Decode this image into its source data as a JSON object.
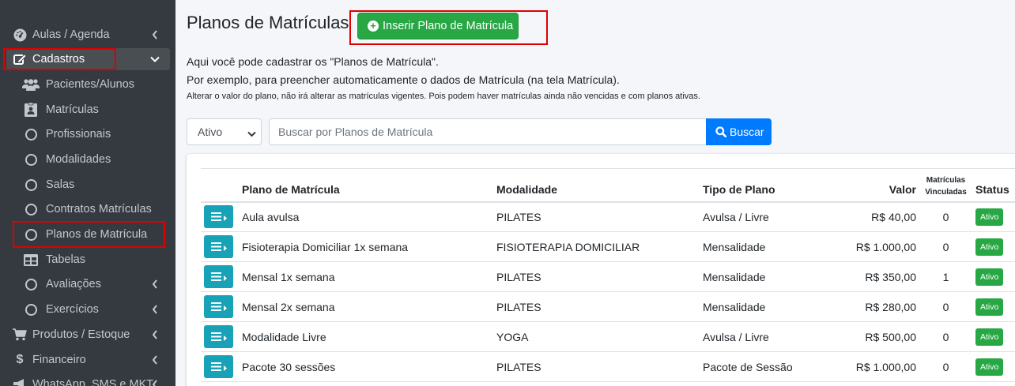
{
  "sidebar": {
    "items": [
      {
        "label": "Aulas / Agenda"
      },
      {
        "label": "Cadastros"
      },
      {
        "label": "Pacientes/Alunos"
      },
      {
        "label": "Matrículas"
      },
      {
        "label": "Profissionais"
      },
      {
        "label": "Modalidades"
      },
      {
        "label": "Salas"
      },
      {
        "label": "Contratos Matrículas"
      },
      {
        "label": "Planos de Matrícula"
      },
      {
        "label": "Tabelas"
      },
      {
        "label": "Avaliações"
      },
      {
        "label": "Exercícios"
      },
      {
        "label": "Produtos / Estoque"
      },
      {
        "label": "Financeiro"
      },
      {
        "label": "WhatsApp, SMS e MKT"
      }
    ]
  },
  "header": {
    "title": "Planos de Matrículas",
    "insert_button": "Inserir Plano de Matrícula"
  },
  "description": {
    "line1": "Aqui você pode cadastrar os \"Planos de Matrícula\".",
    "line2": "Por exemplo, para preencher automaticamente o dados de Matrícula (na tela Matrícula).",
    "line3": "Alterar o valor do plano, não irá alterar as matrículas vigentes. Pois podem haver matrículas ainda não vencidas e com planos ativas."
  },
  "filter": {
    "status_selected": "Ativo",
    "search_placeholder": "Buscar por Planos de Matrícula",
    "search_button": "Buscar"
  },
  "table": {
    "headers": {
      "plano": "Plano de Matrícula",
      "modalidade": "Modalidade",
      "tipo": "Tipo de Plano",
      "valor": "Valor",
      "vinculadas_1": "Matrículas",
      "vinculadas_2": "Vinculadas",
      "status": "Status"
    },
    "rows": [
      {
        "plano": "Aula avulsa",
        "modalidade": "PILATES",
        "tipo": "Avulsa / Livre",
        "valor": "R$ 40,00",
        "vinculadas": "0",
        "status": "Ativo"
      },
      {
        "plano": "Fisioterapia Domiciliar 1x semana",
        "modalidade": "FISIOTERAPIA DOMICILIAR",
        "tipo": "Mensalidade",
        "valor": "R$ 1.000,00",
        "vinculadas": "0",
        "status": "Ativo"
      },
      {
        "plano": "Mensal 1x semana",
        "modalidade": "PILATES",
        "tipo": "Mensalidade",
        "valor": "R$ 350,00",
        "vinculadas": "1",
        "status": "Ativo"
      },
      {
        "plano": "Mensal 2x semana",
        "modalidade": "PILATES",
        "tipo": "Mensalidade",
        "valor": "R$ 280,00",
        "vinculadas": "0",
        "status": "Ativo"
      },
      {
        "plano": "Modalidade Livre",
        "modalidade": "YOGA",
        "tipo": "Avulsa / Livre",
        "valor": "R$ 500,00",
        "vinculadas": "0",
        "status": "Ativo"
      },
      {
        "plano": "Pacote 30 sessões",
        "modalidade": "PILATES",
        "tipo": "Pacote de Sessão",
        "valor": "R$ 1.000,00",
        "vinculadas": "0",
        "status": "Ativo"
      }
    ]
  }
}
